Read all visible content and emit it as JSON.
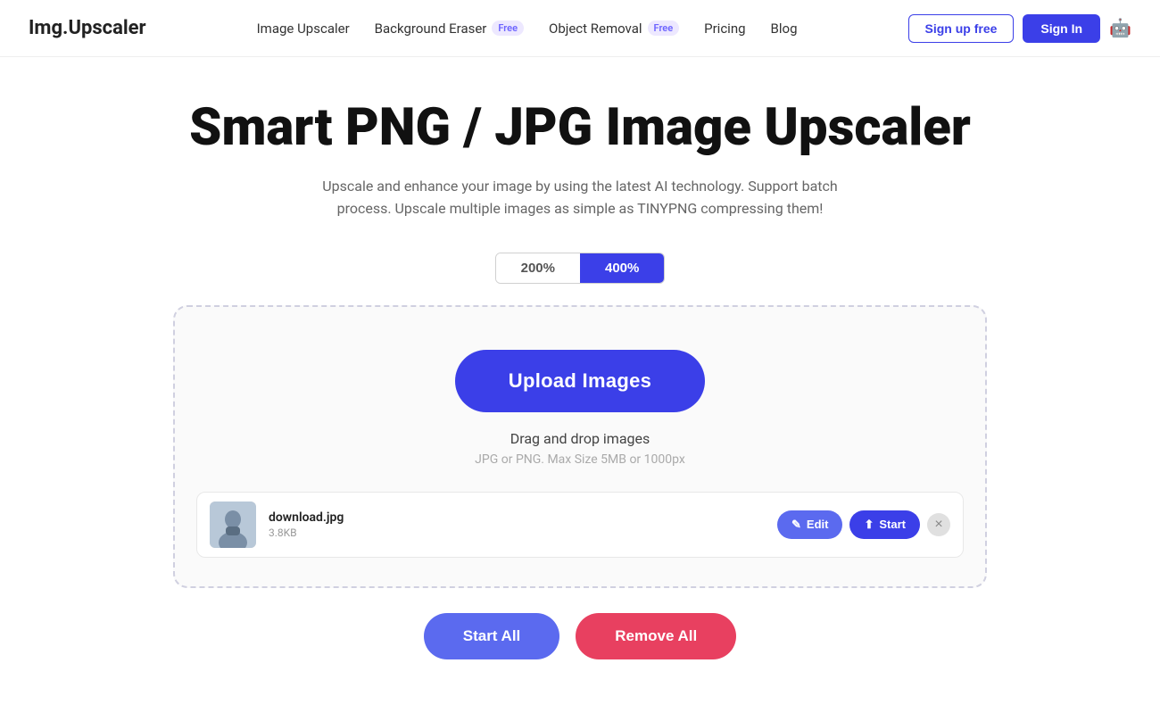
{
  "logo": {
    "text": "Img.Upscaler"
  },
  "nav": {
    "items": [
      {
        "id": "image-upscaler",
        "label": "Image Upscaler",
        "badge": null
      },
      {
        "id": "background-eraser",
        "label": "Background Eraser",
        "badge": "Free"
      },
      {
        "id": "object-removal",
        "label": "Object Removal",
        "badge": "Free"
      },
      {
        "id": "pricing",
        "label": "Pricing",
        "badge": null
      },
      {
        "id": "blog",
        "label": "Blog",
        "badge": null
      }
    ]
  },
  "header_actions": {
    "signup_label": "Sign up free",
    "signin_label": "Sign In"
  },
  "hero": {
    "title": "Smart PNG / JPG Image Upscaler",
    "subtitle": "Upscale and enhance your image by using the latest AI technology. Support batch process. Upscale multiple images as simple as TINYPNG compressing them!"
  },
  "scale_toggle": {
    "options": [
      {
        "id": "200",
        "label": "200%",
        "active": false
      },
      {
        "id": "400",
        "label": "400%",
        "active": true
      }
    ]
  },
  "upload": {
    "button_label": "Upload Images",
    "drag_text": "Drag and drop images",
    "hint_text": "JPG or PNG. Max Size 5MB or 1000px"
  },
  "files": [
    {
      "name": "download.jpg",
      "size": "3.8KB",
      "edit_label": "Edit",
      "start_label": "Start"
    }
  ],
  "bottom_actions": {
    "start_all_label": "Start All",
    "remove_all_label": "Remove All"
  },
  "icons": {
    "edit": "✎",
    "start": "↑",
    "close": "×",
    "robot": "🤖"
  }
}
